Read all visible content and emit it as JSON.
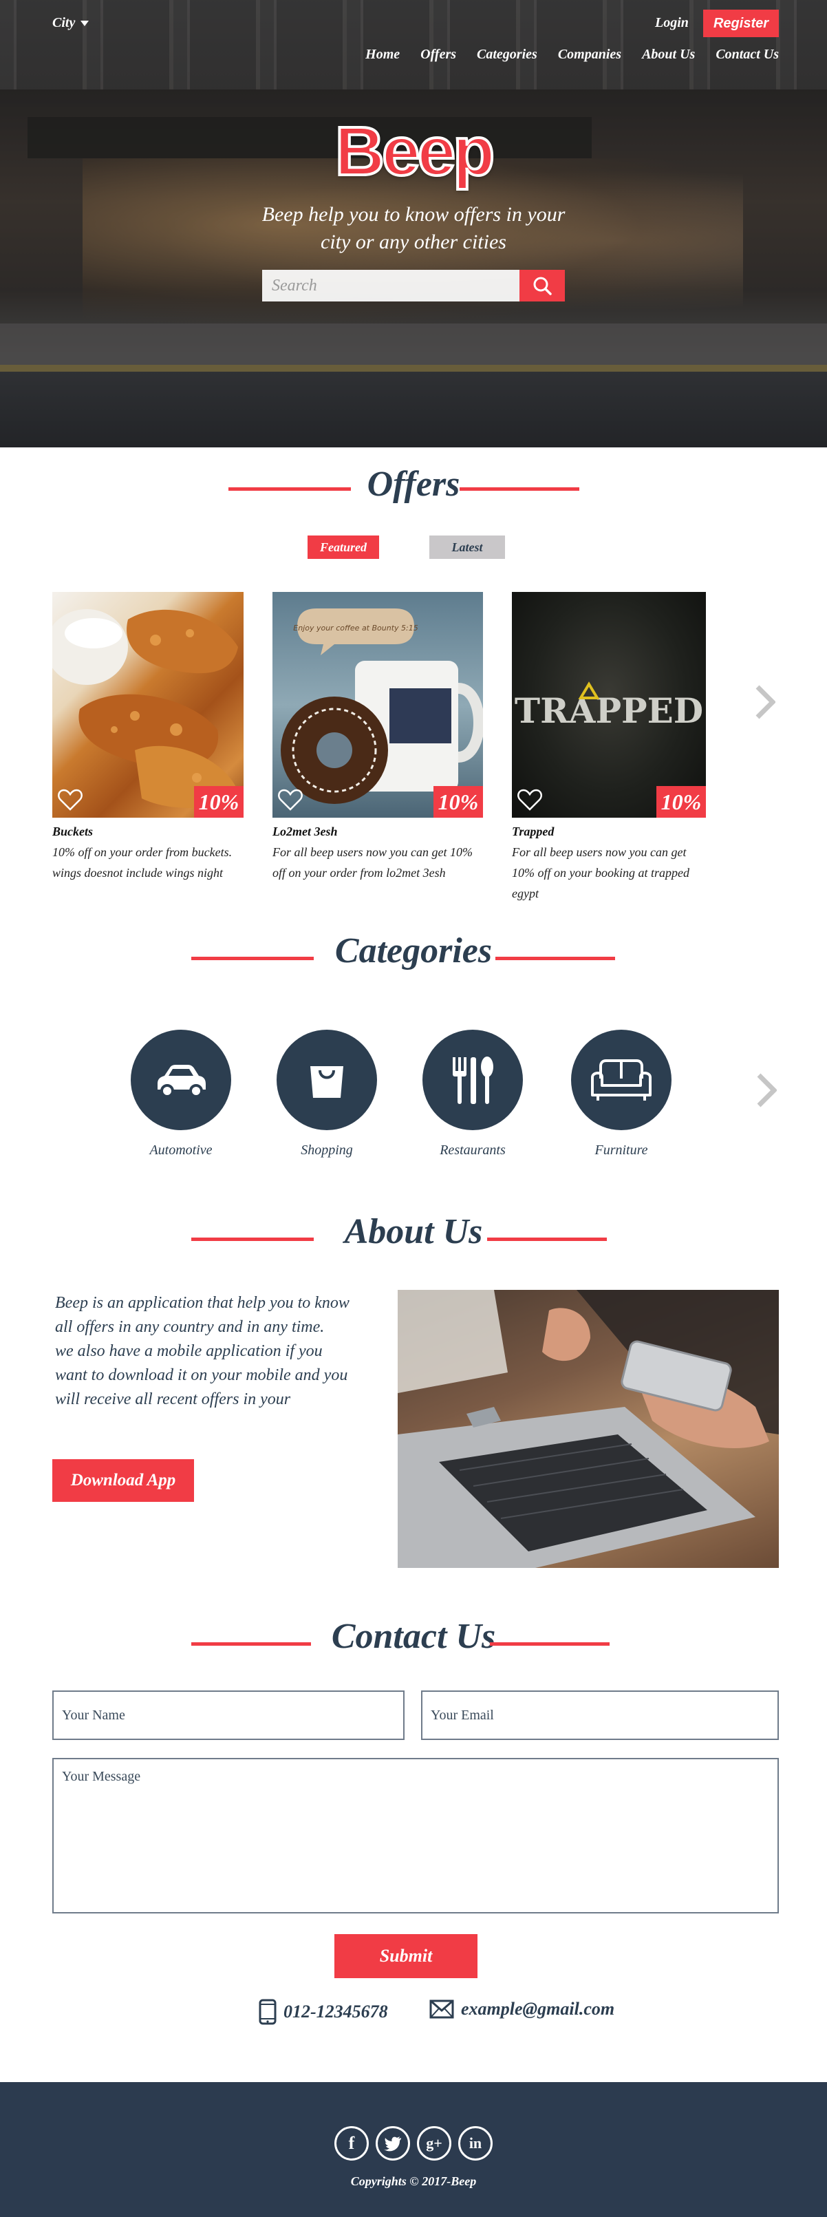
{
  "header": {
    "city_label": "City",
    "login_label": "Login",
    "register_label": "Register",
    "nav": [
      "Home",
      "Offers",
      "Categories",
      "Companies",
      "About Us",
      "Contact Us"
    ]
  },
  "hero": {
    "logo": "Beep",
    "tagline": "Beep help you to know offers in your city or any other cities",
    "search_placeholder": "Search"
  },
  "offers": {
    "title": "Offers",
    "tabs": {
      "featured": "Featured",
      "latest": "Latest"
    },
    "items": [
      {
        "title": "Buckets",
        "discount": "10%",
        "description": "10% off on your order from buckets. wings doesnot include wings night"
      },
      {
        "title": "Lo2met 3esh",
        "discount": "10%",
        "description": "For all beep users now you can get 10% off on your order from lo2met 3esh",
        "image_text": "Enjoy your coffee at Bounty 5:15"
      },
      {
        "title": "Trapped",
        "discount": "10%",
        "description": "For all beep users now you can get 10% off on your booking at trapped egypt",
        "image_text": "TRAPPED"
      }
    ]
  },
  "categories": {
    "title": "Categories",
    "items": [
      {
        "label": "Automotive",
        "icon": "car-icon"
      },
      {
        "label": "Shopping",
        "icon": "shopping-bag-icon"
      },
      {
        "label": "Restaurants",
        "icon": "cutlery-icon"
      },
      {
        "label": "Furniture",
        "icon": "sofa-icon"
      }
    ]
  },
  "about": {
    "title": "About Us",
    "line1": "Beep is an application that help you to know all offers in any country and in any time.",
    "line2": "we also have a mobile application if you want to download it on your mobile and you will receive all recent offers in your",
    "download_label": "Download App"
  },
  "contact": {
    "title": "Contact Us",
    "name_placeholder": "Your Name",
    "email_placeholder": "Your Email",
    "message_placeholder": "Your Message",
    "submit_label": "Submit",
    "phone": "012-12345678",
    "email": "example@gmail.com"
  },
  "footer": {
    "social": [
      "f",
      "twitter",
      "g+",
      "in"
    ],
    "copyright": "Copyrights © 2017-Beep"
  },
  "colors": {
    "accent": "#f13c45",
    "dark": "#2c3e50",
    "footer": "#2c3b4f"
  }
}
